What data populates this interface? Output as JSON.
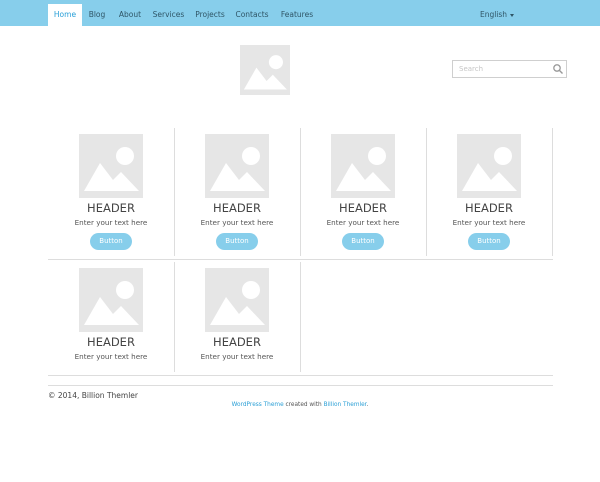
{
  "nav": {
    "items": [
      {
        "label": "Home"
      },
      {
        "label": "Blog"
      },
      {
        "label": "About"
      },
      {
        "label": "Services"
      },
      {
        "label": "Projects"
      },
      {
        "label": "Contacts"
      },
      {
        "label": "Features"
      }
    ],
    "language": "English"
  },
  "search": {
    "placeholder": "Search"
  },
  "cards": [
    {
      "header": "HEADER",
      "text": "Enter your text here",
      "button": "Button"
    },
    {
      "header": "HEADER",
      "text": "Enter your text here",
      "button": "Button"
    },
    {
      "header": "HEADER",
      "text": "Enter your text here",
      "button": "Button"
    },
    {
      "header": "HEADER",
      "text": "Enter your text here",
      "button": "Button"
    },
    {
      "header": "HEADER",
      "text": "Enter your text here"
    },
    {
      "header": "HEADER",
      "text": "Enter your text here"
    }
  ],
  "footer": {
    "copyright": "© 2014, Billion Themler",
    "credit_link1": "WordPress Theme",
    "credit_mid": " created with ",
    "credit_link2": "Billion Themler",
    "credit_end": "."
  },
  "colors": {
    "accent": "#87ceeb",
    "link": "#2a9fd6",
    "placeholder_gray": "#e6e6e6"
  }
}
